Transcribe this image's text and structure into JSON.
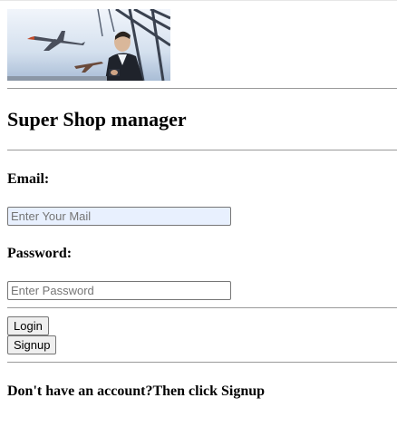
{
  "header": {
    "banner_image": "business-travel-airplane-banner"
  },
  "page_title": "Super Shop manager",
  "form": {
    "email_label": "Email:",
    "email_placeholder": "Enter Your Mail",
    "email_value": "",
    "password_label": "Password:",
    "password_placeholder": "Enter Password",
    "password_value": "",
    "login_label": "Login",
    "signup_label": "Signup"
  },
  "footer_note": "Don't have an account?Then click Signup",
  "colors": {
    "focused_input_bg": "#e8f0fe",
    "rule": "#9a9a9a",
    "button_bg": "#efefef"
  }
}
